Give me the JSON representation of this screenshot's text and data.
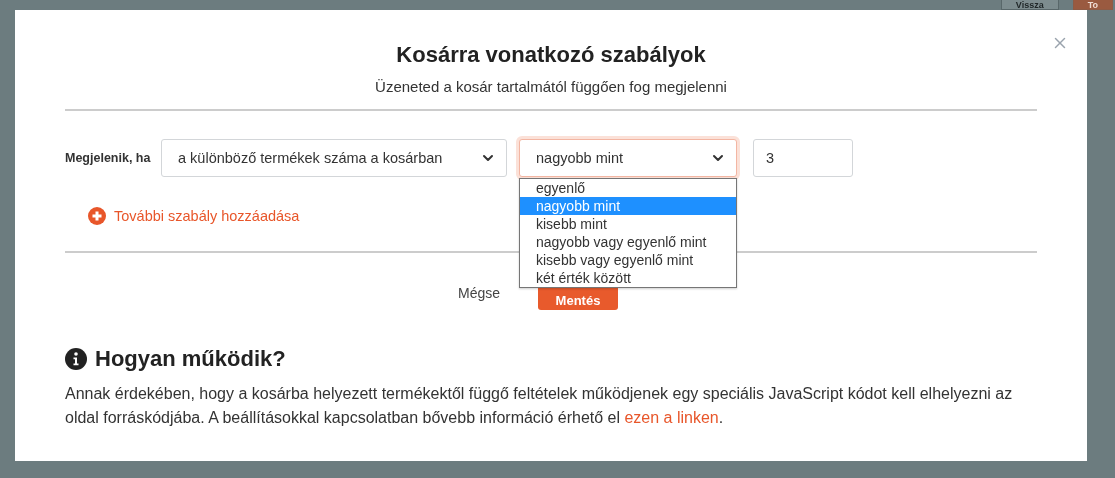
{
  "background_header": {
    "buttons": [
      {
        "label": "Vissza",
        "kind": "secondary"
      },
      {
        "label": "To",
        "kind": "primary"
      }
    ]
  },
  "modal": {
    "title": "Kosárra vonatkozó szabályok",
    "subtitle": "Üzeneted a kosár tartalmától függően fog megjelenni",
    "rule": {
      "label": "Megjelenik, ha",
      "field": {
        "value": "a különböző termékek száma a kosárban"
      },
      "operator": {
        "value": "nagyobb mint",
        "expanded": true,
        "options": [
          {
            "label": "egyenlő",
            "selected": false
          },
          {
            "label": "nagyobb mint",
            "selected": true
          },
          {
            "label": "kisebb mint",
            "selected": false
          },
          {
            "label": "nagyobb vagy egyenlő mint",
            "selected": false
          },
          {
            "label": "kisebb vagy egyenlő mint",
            "selected": false
          },
          {
            "label": "két érték között",
            "selected": false
          }
        ]
      },
      "amount": {
        "value": "3"
      }
    },
    "add_rule_link": "További szabály hozzáadása",
    "buttons": {
      "cancel": "Mégse",
      "save": "Mentés"
    },
    "help": {
      "heading": "Hogyan működik?",
      "text": "Annak érdekében, hogy a kosárba helyezett termékektől függő feltételek működjenek egy speciális JavaScript kódot kell elhelyezni az oldal forráskódjába. A beállításokkal kapcsolatban bővebb információ érhető el ",
      "link": "ezen a linken",
      "text_after": "."
    }
  }
}
